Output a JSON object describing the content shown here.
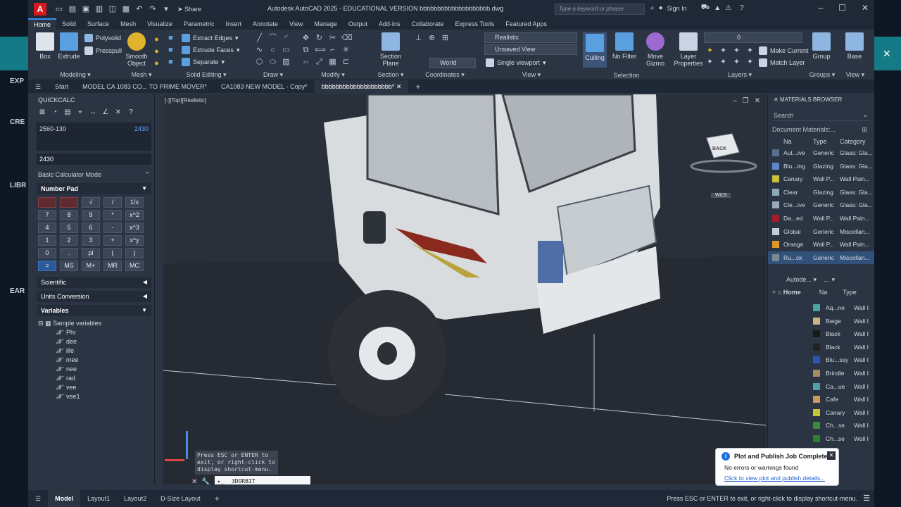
{
  "outer": {
    "left_labels": [
      "EXP",
      "CRE",
      "LIBR",
      "EAR"
    ]
  },
  "titlebar": {
    "app_letter": "A",
    "share_label": "Share",
    "title": "Autodesk AutoCAD 2025 - EDUCATIONAL VERSION     bbbbbbbbbbbbbbbbbbbb.dwg",
    "search_placeholder": "Type a keyword or phrase",
    "sign_in": "Sign In"
  },
  "ribbon_tabs": [
    "Home",
    "Solid",
    "Surface",
    "Mesh",
    "Visualize",
    "Parametric",
    "Insert",
    "Annotate",
    "View",
    "Manage",
    "Output",
    "Add-ins",
    "Collaborate",
    "Express Tools",
    "Featured Apps"
  ],
  "ribbon": {
    "modeling": {
      "title": "Modeling",
      "box": "Box",
      "extrude": "Extrude",
      "polysolid": "Polysolid",
      "presspull": "Presspull"
    },
    "mesh": {
      "title": "Mesh",
      "smooth_object": "Smooth Object"
    },
    "solid_editing": {
      "title": "Solid Editing",
      "extract_edges": "Extract Edges",
      "extrude_faces": "Extrude Faces",
      "separate": "Separate"
    },
    "draw": {
      "title": "Draw"
    },
    "modify": {
      "title": "Modify"
    },
    "section": {
      "title": "Section",
      "section_plane": "Section Plane"
    },
    "coordinates": {
      "title": "Coordinates",
      "world": "World"
    },
    "view": {
      "title": "View",
      "visual_style": "Realistic",
      "named_view": "Unsaved View",
      "viewport": "Single viewport"
    },
    "selection": {
      "title": "Selection",
      "culling": "Culling",
      "no_filter": "No Filter",
      "move_gizmo": "Move Gizmo"
    },
    "layers": {
      "title": "Layers",
      "layer_properties": "Layer Properties",
      "layer_value": "0",
      "make_current": "Make Current",
      "match_layer": "Match Layer"
    },
    "groups": {
      "title": "Groups",
      "group": "Group"
    },
    "view2": {
      "title": "View",
      "base": "Base"
    }
  },
  "file_tabs": [
    "Start",
    "MODEL CA 1083 CO... TO PRIME MOVER*",
    "CA1083 NEW MODEL - Copy*",
    "bbbbbbbbbbbbbbbbbbbb*"
  ],
  "quickcalc": {
    "title": "QUICKCALC",
    "expression": "2560-130",
    "result": "2430",
    "input": "2430",
    "mode": "Basic Calculator Mode",
    "number_pad": "Number Pad",
    "keys": [
      "",
      "",
      "√",
      "/",
      "1/x",
      "7",
      "8",
      "9",
      "*",
      "x^2",
      "4",
      "5",
      "6",
      "-",
      "x^3",
      "1",
      "2",
      "3",
      "+",
      "x^y",
      "0",
      ".",
      "pi",
      "(",
      ")",
      "=",
      "MS",
      "M+",
      "MR",
      "MC"
    ],
    "scientific": "Scientific",
    "units_conversion": "Units Conversion",
    "variables": "Variables",
    "sample_variables": "Sample variables",
    "var_list": [
      "Phi",
      "dee",
      "ille",
      "mee",
      "nee",
      "rad",
      "vee",
      "vee1"
    ]
  },
  "viewport": {
    "label": "[-][Top][Realistic]",
    "viewcube_label": "BACK",
    "wcs_label": "WCS",
    "cmd_tip": "Press ESC or ENTER to exit, or right-click to display shortcut-menu.",
    "cmd_value": "3DORBIT"
  },
  "materials": {
    "title": "MATERIALS BROWSER",
    "search": "Search",
    "doc_materials": "Document Materials:...",
    "head": [
      "Na",
      "Type",
      "Category"
    ],
    "rows": [
      {
        "name": "Aut...ive",
        "type": "Generic",
        "category": "Glass: Gla...",
        "color": "#5b6e8a"
      },
      {
        "name": "Blu...ing",
        "type": "Glazing",
        "category": "Glass: Gla...",
        "color": "#5f86c9"
      },
      {
        "name": "Canary",
        "type": "Wall P...",
        "category": "Wall Pain...",
        "color": "#c8c23a"
      },
      {
        "name": "Clear",
        "type": "Glazing",
        "category": "Glass: Gla...",
        "color": "#8fa8b8"
      },
      {
        "name": "Cle...ive",
        "type": "Generic",
        "category": "Glass: Gla...",
        "color": "#9aa9b8"
      },
      {
        "name": "Da...ed",
        "type": "Wall P...",
        "category": "Wall Pain...",
        "color": "#a51c2a"
      },
      {
        "name": "Global",
        "type": "Generic",
        "category": "Miscellan...",
        "color": "#c9ced6"
      },
      {
        "name": "Orange",
        "type": "Wall P...",
        "category": "Wall Pain...",
        "color": "#e0962a"
      },
      {
        "name": "Ru...ck",
        "type": "Generic",
        "category": "Miscellan...",
        "color": "#7c8898"
      }
    ],
    "library": "Autode...",
    "home": "Home",
    "lib_head": [
      "Na",
      "Type"
    ],
    "lib_rows": [
      {
        "name": "Aq...ne",
        "type": "Wall I",
        "color": "#4aa5a5"
      },
      {
        "name": "Beige",
        "type": "Wall I",
        "color": "#c9b48a"
      },
      {
        "name": "Black",
        "type": "Wall I",
        "color": "#1a1a1a"
      },
      {
        "name": "Black",
        "type": "Wall I",
        "color": "#222222"
      },
      {
        "name": "Blu...ssy",
        "type": "Wall I",
        "color": "#2e54b8"
      },
      {
        "name": "Brindle",
        "type": "Wall I",
        "color": "#a68a60"
      },
      {
        "name": "Ca...ue",
        "type": "Wall I",
        "color": "#4fa0a8"
      },
      {
        "name": "Cafe",
        "type": "Wall I",
        "color": "#c89a5e"
      },
      {
        "name": "Canary",
        "type": "Wall I",
        "color": "#c8c23a"
      },
      {
        "name": "Ch...se",
        "type": "Wall I",
        "color": "#3a8a3a"
      },
      {
        "name": "Ch...se",
        "type": "Wall I",
        "color": "#2f7d2f"
      }
    ]
  },
  "notification": {
    "title": "Plot and Publish Job Complete",
    "message": "No errors or warnings found",
    "link": "Click to view plot and publish details..."
  },
  "status": {
    "tabs": [
      "Model",
      "Layout1",
      "Layout2",
      "D-Size Layout"
    ],
    "message": "Press ESC or ENTER to exit, or right-click to display shortcut-menu."
  }
}
